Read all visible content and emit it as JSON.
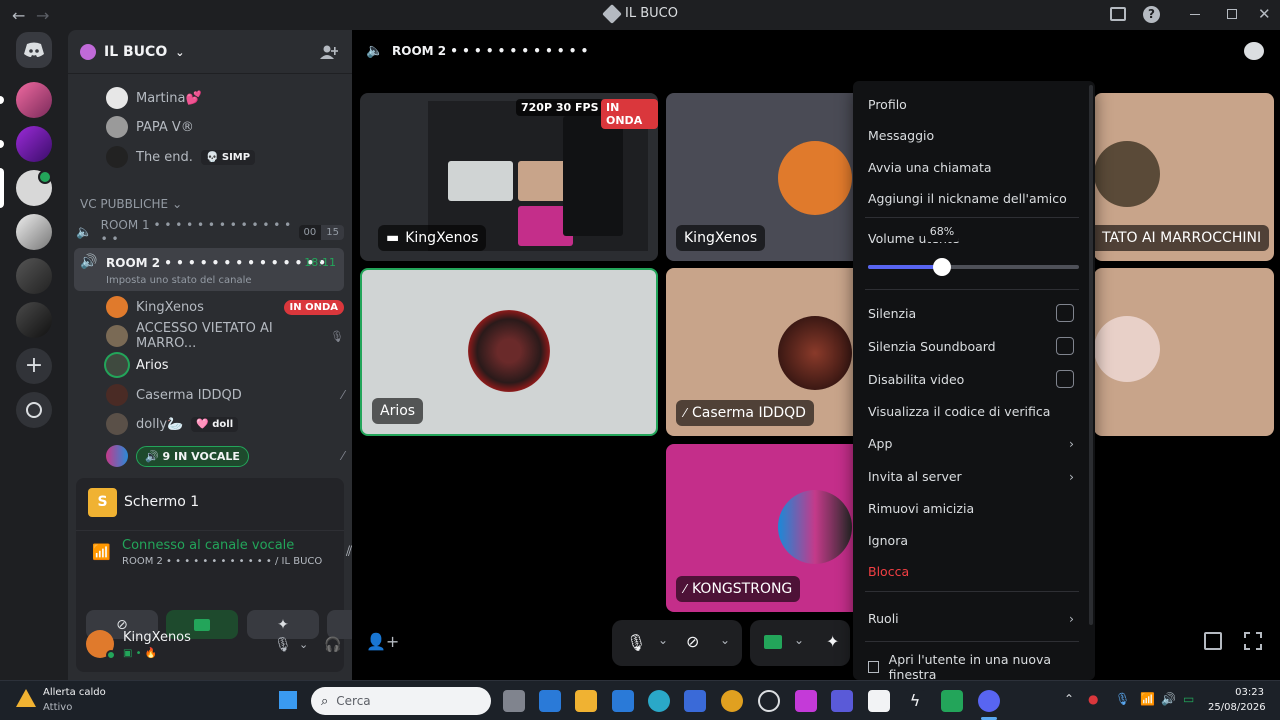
{
  "window": {
    "title": "IL BUCO"
  },
  "server": {
    "name": "IL BUCO"
  },
  "sidebar": {
    "top_users": [
      {
        "name": "Martina💕",
        "avatar_color": "#e7e7e7"
      },
      {
        "name": "PAPA V®",
        "avatar_color": "#9a9a9a"
      },
      {
        "name": "The end.",
        "tag": "💀 SIMP",
        "avatar_color": "#222"
      }
    ],
    "category": "VC PUBBLICHE",
    "room1": {
      "name": "ROOM 1 • • • • • • • • • • • • • • •",
      "count_a": "00",
      "count_b": "15"
    },
    "room2": {
      "name": "ROOM 2 • • • • • • • • • • • • • •",
      "time": "18:11",
      "status_hint": "Imposta uno stato del canale"
    },
    "voice_users": [
      {
        "name": "KingXenos",
        "badge": "IN ONDA",
        "avatar_color": "#e07a2c"
      },
      {
        "name": "ACCESSO VIETATO AI MARRO...",
        "avatar_color": "#7a6a55"
      },
      {
        "name": "Arios",
        "avatar_color": "#3f4a3f"
      },
      {
        "name": "Caserma IDDQD",
        "avatar_color": "#4a2b25"
      },
      {
        "name": "dolly🦢",
        "tag": "🩷 doll",
        "avatar_color": "#5a5048"
      }
    ],
    "in_voice_label": "9 IN VOCALE"
  },
  "screen_share": {
    "title": "Schermo 1",
    "icon_letter": "S"
  },
  "voice_status": {
    "title": "Connesso al canale vocale",
    "sub": "ROOM 2 • • • • • • • • • • • • / IL BUCO"
  },
  "user_panel": {
    "name": "KingXenos"
  },
  "stage": {
    "channel_name": "ROOM 2 • • • • • • • • • • • •",
    "stream_quality": "720P 30 FPS",
    "stream_live": "IN ONDA",
    "tiles": [
      {
        "label": "KingXenos"
      },
      {
        "label": "KingXenos"
      },
      {
        "label": "ACCESSO VIETATO AI MARROCCHINI",
        "label_visible": "TATO AI MARROCCHINI"
      },
      {
        "label": "Arios"
      },
      {
        "label": "Caserma IDDQD"
      },
      {
        "label": "KONGSTRONG"
      }
    ]
  },
  "context_menu": {
    "items_top": [
      "Profilo",
      "Messaggio",
      "Avvia una chiamata",
      "Aggiungi il nickname dell'amico"
    ],
    "volume_label": "Volume utente",
    "volume_value_text": "68%",
    "volume_fraction": 0.68,
    "checks": [
      "Silenzia",
      "Silenzia Soundboard",
      "Disabilita video"
    ],
    "verify": "Visualizza il codice di verifica",
    "app": "App",
    "invite": "Invita al server",
    "remove": "Rimuovi amicizia",
    "ignore": "Ignora",
    "block": "Blocca",
    "roles": "Ruoli",
    "open_window": "Apri l'utente in una nuova finestra"
  },
  "taskbar": {
    "alert_title": "Allerta caldo",
    "alert_sub": "Attivo",
    "search_placeholder": "Cerca",
    "time": "03:23",
    "date": "25/08/2026"
  }
}
